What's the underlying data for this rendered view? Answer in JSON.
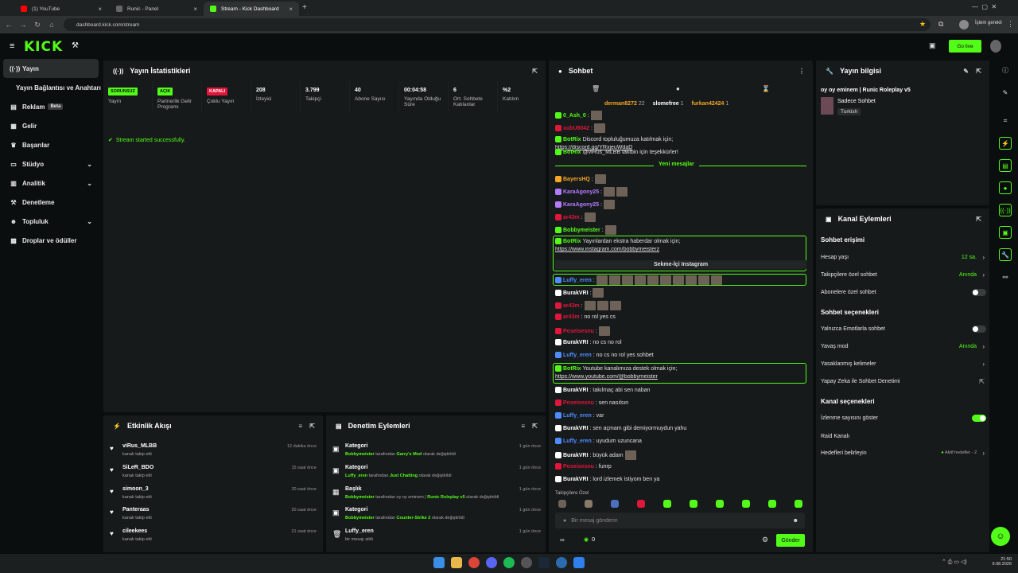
{
  "browser": {
    "tabs": [
      {
        "label": "(1) YouTube",
        "color": "#ff0000"
      },
      {
        "label": "Runic - Panel",
        "color": "#666666"
      },
      {
        "label": "Stream - Kick Dashboard",
        "color": "#53fc18"
      }
    ],
    "url": "dashboard.kick.com/stream",
    "profile": "İşlem gerekli"
  },
  "app": {
    "logo": "KICK",
    "go_live": "Go live",
    "accent": "#53fc18"
  },
  "sidebar": {
    "items": [
      {
        "label": "Yayın",
        "icon": "broadcast-icon",
        "active": true
      },
      {
        "label": "Yayın Bağlantısı ve Anahtarı",
        "icon": ""
      },
      {
        "label": "Reklam",
        "icon": "ad-icon",
        "badge": "Beta"
      },
      {
        "label": "Gelir",
        "icon": "money-icon"
      },
      {
        "label": "Başarılar",
        "icon": "trophy-icon"
      },
      {
        "label": "Stüdyo",
        "icon": "studio-icon",
        "chevron": true
      },
      {
        "label": "Analitik",
        "icon": "chart-icon",
        "chevron": true
      },
      {
        "label": "Denetleme",
        "icon": "hammer-icon"
      },
      {
        "label": "Topluluk",
        "icon": "community-icon",
        "chevron": true
      },
      {
        "label": "Droplar ve ödüller",
        "icon": "gift-icon"
      }
    ]
  },
  "stats": {
    "title": "Yayın İstatistikleri",
    "cells": [
      {
        "badge": "SORUNSUZ",
        "badge_color": "#53fc18",
        "label": "Yayın"
      },
      {
        "badge": "AÇIK",
        "badge_color": "#53fc18",
        "label": "Partnerlik Gelir Programı"
      },
      {
        "badge": "KAPALI",
        "badge_color": "#e0163b",
        "label": "Çoklu Yayın"
      },
      {
        "value": "208",
        "label": "İzleyici"
      },
      {
        "value": "3.799",
        "label": "Takipçi"
      },
      {
        "value": "40",
        "label": "Abone Sayısı"
      },
      {
        "value": "00:04:58",
        "label": "Yayında Olduğu Süre"
      },
      {
        "value": "6",
        "label": "Ort. Sohbete Katılanlar"
      },
      {
        "value": "%2",
        "label": "Katılım"
      }
    ],
    "status": "Stream started successfully."
  },
  "activity": {
    "title": "Etkinlik Akışı",
    "items": [
      {
        "name": "viRus_MLBB",
        "sub": "kanalı takip etti",
        "time": "12 dakika önce"
      },
      {
        "name": "SiLeR_BDO",
        "sub": "kanalı takip etti",
        "time": "15 saat önce"
      },
      {
        "name": "simoon_3",
        "sub": "kanalı takip etti",
        "time": "20 saat önce"
      },
      {
        "name": "Panteraas",
        "sub": "kanalı takip etti",
        "time": "20 saat önce"
      },
      {
        "name": "cileekees",
        "sub": "kanalı takip etti",
        "time": "21 saat önce"
      }
    ]
  },
  "moderation": {
    "title": "Denetim Eylemleri",
    "items": [
      {
        "title": "Kategori",
        "user": "Bobbymeister",
        "mid": "tarafından",
        "target": "Garry's Mod",
        "end": "olarak değiştirildi",
        "time": "1 gün önce"
      },
      {
        "title": "Kategori",
        "user": "Luffy_eren",
        "mid": "tarafından",
        "target": "Just Chatting",
        "end": "olarak değiştirildi",
        "time": "1 gün önce"
      },
      {
        "title": "Başlık",
        "user": "Bobbymeister",
        "mid": "tarafından oy oy eminem |",
        "target": "Runic Roleplay v5",
        "end": "olarak değiştirildi",
        "time": "1 gün önce"
      },
      {
        "title": "Kategori",
        "user": "Bobbymeister",
        "mid": "tarafından",
        "target": "Counter-Strike 2",
        "end": "olarak değiştirildi",
        "time": "1 gün önce"
      },
      {
        "title": "Luffy_eren",
        "user": "",
        "mid": "bir mesajı sildi",
        "target": "",
        "end": "",
        "time": "1 gün önce"
      }
    ]
  },
  "chat": {
    "title": "Sohbet",
    "top_gifters": [
      {
        "name": "derman8272",
        "count": "22",
        "color": "#f5a524"
      },
      {
        "name": "slomefree",
        "count": "1",
        "color": "#ffffff"
      },
      {
        "name": "furkan42424",
        "count": "1",
        "color": "#f5a524"
      }
    ],
    "new_messages": "Yeni mesajlar",
    "messages": [
      {
        "user": "0_Ash_0",
        "color": "#53fc18",
        "text": ":",
        "emotes": 1
      },
      {
        "user": "xubU8042",
        "color": "#e0163b",
        "text": ":",
        "emotes": 1
      },
      {
        "user": "BotRix",
        "color": "#53fc18",
        "text": "Discord topluluğumuza katılmak için;",
        "link": "https://discord.gg/YRxjeuWdaD"
      },
      {
        "user": "BotRix",
        "color": "#53fc18",
        "text": "@viRus_MLBB takibin için teşekkürler!"
      },
      {
        "user": "BayersHQ",
        "color": "#f5a524",
        "text": ":",
        "emotes": 1
      },
      {
        "user": "KaraAgony25",
        "color": "#b57bff",
        "text": ":",
        "emotes": 2
      },
      {
        "user": "KaraAgony25",
        "color": "#b57bff",
        "text": ":",
        "emotes": 1
      },
      {
        "user": "ar43m",
        "color": "#e0163b",
        "text": ":",
        "emotes": 1
      },
      {
        "user": "Bobbymeister",
        "color": "#53fc18",
        "text": ":",
        "emotes": 1
      },
      {
        "user": "BotRix",
        "color": "#53fc18",
        "text": "Yayınlardan ekstra haberdar olmak için;",
        "link": "https://www.instagram.com/bobbymeisterz",
        "button": "Sekme-İçi Instagram"
      },
      {
        "user": "Luffy_eren",
        "color": "#4f8cff",
        "text": ":",
        "emotes": 10
      },
      {
        "user": "BurakVRI",
        "color": "#ffffff",
        "text": ":",
        "emotes": 1
      },
      {
        "user": "ar43m",
        "color": "#e0163b",
        "text": ":",
        "emotes": 3
      },
      {
        "user": "ar43m",
        "color": "#e0163b",
        "text": ": no rol yes cs"
      },
      {
        "user": "Poseisesnu",
        "color": "#e0163b",
        "text": ":",
        "emotes": 1
      },
      {
        "user": "BurakVRI",
        "color": "#ffffff",
        "text": ": no cs no rol"
      },
      {
        "user": "Luffy_eren",
        "color": "#4f8cff",
        "text": ": no cs no rol yes sohbet"
      },
      {
        "user": "BotRix",
        "color": "#53fc18",
        "text": "Youtube kanalımıza destek olmak için;",
        "link": "https://www.youtube.com/@bobbymeister"
      },
      {
        "user": "BurakVRI",
        "color": "#ffffff",
        "text": ": takılmaç abi sen naban"
      },
      {
        "user": "Poseisesnu",
        "color": "#e0163b",
        "text": ": sen nasılsın"
      },
      {
        "user": "Luffy_eren",
        "color": "#4f8cff",
        "text": ": var"
      },
      {
        "user": "BurakVRI",
        "color": "#ffffff",
        "text": ": sen açmam gibi demiyormuydun yahu"
      },
      {
        "user": "Luffy_eren",
        "color": "#4f8cff",
        "text": ": uyudum uzuncana"
      },
      {
        "user": "BurakVRI",
        "color": "#ffffff",
        "text": ": büyük adam",
        "emotes": 1
      },
      {
        "user": "Poseisesnu",
        "color": "#e0163b",
        "text": ": funrp"
      },
      {
        "user": "BurakVRI",
        "color": "#ffffff",
        "text": ": lord izlemek istiyom ben ya"
      }
    ],
    "emote_bar_label": "Takipçilere Özel",
    "input_placeholder": "Bir mesaj gönderin",
    "points": "0",
    "send": "Gönder"
  },
  "stream_info": {
    "title": "Yayın bilgisi",
    "stream_title": "oy oy eminem | Runic Roleplay v5",
    "category": "Sadece Sohbet",
    "language": "Turkish"
  },
  "channel_actions": {
    "title": "Kanal Eylemleri",
    "sections": [
      {
        "name": "Sohbet erişimi",
        "rows": [
          {
            "label": "Hesap yaşı",
            "value": "12 sa.",
            "kind": "arrow"
          },
          {
            "label": "Takipçilere özel sohbet",
            "value": "Anında",
            "kind": "arrow"
          },
          {
            "label": "Abonelere özel sohbet",
            "kind": "toggle",
            "on": false
          }
        ]
      },
      {
        "name": "Sohbet seçenekleri",
        "rows": [
          {
            "label": "Yalnızca Emotlarla sohbet",
            "kind": "toggle",
            "on": false
          },
          {
            "label": "Yavaş mod",
            "value": "Anında",
            "kind": "arrow"
          },
          {
            "label": "Yasaklanmış kelimeler",
            "kind": "arrow"
          },
          {
            "label": "Yapay Zeka ile Sohbet Denetimi",
            "kind": "ext"
          }
        ]
      },
      {
        "name": "Kanal seçenekleri",
        "rows": [
          {
            "label": "İzlenme sayısını göster",
            "kind": "toggle",
            "on": true
          },
          {
            "label": "Raid Kanalı",
            "kind": "none"
          },
          {
            "label": "Hedefleri belirleyin",
            "value": "Aktif hedefler - 2",
            "kind": "arrow-dot"
          }
        ]
      }
    ]
  },
  "taskbar": {
    "time": "21:50",
    "date": "9.08.2026"
  }
}
